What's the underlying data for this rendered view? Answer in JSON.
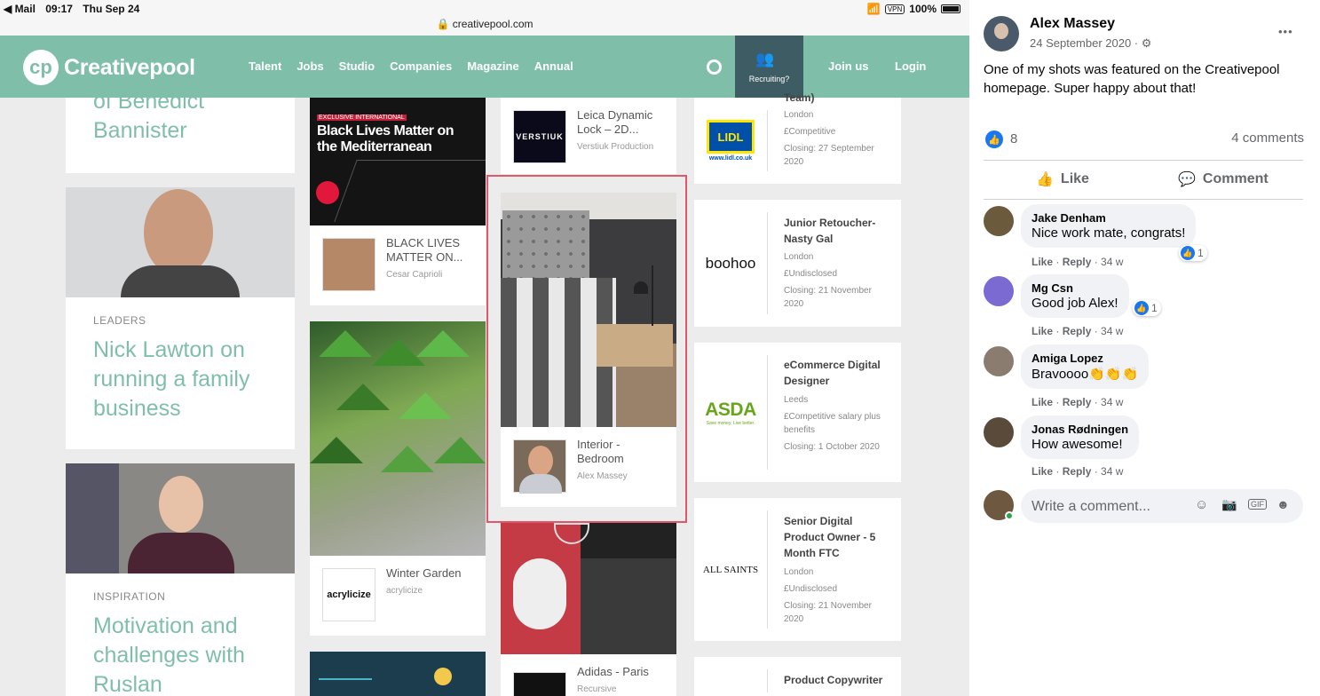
{
  "status": {
    "back": "◀ Mail",
    "time": "09:17",
    "date": "Thu Sep 24",
    "url": "creativepool.com",
    "vpn": "VPN",
    "battery": "100%"
  },
  "nav": {
    "brand": "Creativepool",
    "links": [
      "Talent",
      "Jobs",
      "Studio",
      "Companies",
      "Magazine",
      "Annual"
    ],
    "recruiting": "Recruiting?",
    "join": "Join us",
    "login": "Login"
  },
  "articles": [
    {
      "title": "of Benedict Bannister"
    },
    {
      "category": "LEADERS",
      "title": "Nick Lawton on running a family business"
    },
    {
      "category": "INSPIRATION",
      "title": "Motivation and challenges with Ruslan"
    }
  ],
  "projects": {
    "blm": {
      "banner": "Black Lives Matter on the Mediterranean",
      "small": "EXCLUSIVE INTERNATIONAL",
      "title": "BLACK LIVES MATTER ON...",
      "author": "Cesar Caprioli"
    },
    "winter": {
      "title": "Winter Garden",
      "author": "acrylicize",
      "logo": "acrylicize"
    },
    "leica": {
      "title": "Leica Dynamic Lock – 2D...",
      "author": "Verstiuk Production",
      "logo": "VERSTIUK"
    },
    "bedroom": {
      "title": "Interior - Bedroom",
      "author": "Alex Massey"
    },
    "adidas": {
      "title": "Adidas - Paris",
      "author": "Recursive"
    }
  },
  "jobs": [
    {
      "title": "Team)",
      "location": "London",
      "salary": "£Competitive",
      "closing": "Closing: 27 September 2020",
      "logo": "LIDL",
      "logo_sub": "www.lidl.co.uk"
    },
    {
      "title": "Junior Retoucher- Nasty Gal",
      "location": "London",
      "salary": "£Undisclosed",
      "closing": "Closing: 21 November 2020",
      "logo": "boohoo"
    },
    {
      "title": "eCommerce Digital Designer",
      "location": "Leeds",
      "salary": "£Competitive salary plus benefits",
      "closing": "Closing: 1 October 2020",
      "logo": "ASDA",
      "logo_sub": "Save money. Live better."
    },
    {
      "title": "Senior Digital Product Owner - 5 Month FTC",
      "location": "London",
      "salary": "£Undisclosed",
      "closing": "Closing: 21 November 2020",
      "logo": "ALL SAINTS"
    },
    {
      "title": "Product Copywriter"
    }
  ],
  "post": {
    "author": "Alex Massey",
    "date": "24 September 2020 ·",
    "more": "•••",
    "text": "One of my shots was featured on the Creativepool homepage. Super happy about that!",
    "likes": "8",
    "comments_count": "4 comments",
    "like_label": "Like",
    "comment_label": "Comment"
  },
  "comments": [
    {
      "name": "Jake Denham",
      "text": "Nice work mate, congrats!",
      "reactions": "1",
      "like": "Like",
      "reply": "Reply",
      "age": "34 w"
    },
    {
      "name": "Mg Csn",
      "text": "Good job Alex!",
      "reactions": "1",
      "like": "Like",
      "reply": "Reply",
      "age": "34 w"
    },
    {
      "name": "Amiga Lopez",
      "text": "Bravoooo👏👏👏",
      "like": "Like",
      "reply": "Reply",
      "age": "34 w"
    },
    {
      "name": "Jonas Rødningen",
      "text": "How awesome!",
      "like": "Like",
      "reply": "Reply",
      "age": "34 w"
    }
  ],
  "composer": {
    "placeholder": "Write a comment..."
  },
  "colors": {
    "brand": "#7fbfaa",
    "fb_blue": "#1877f2",
    "highlight": "#e0566a"
  }
}
